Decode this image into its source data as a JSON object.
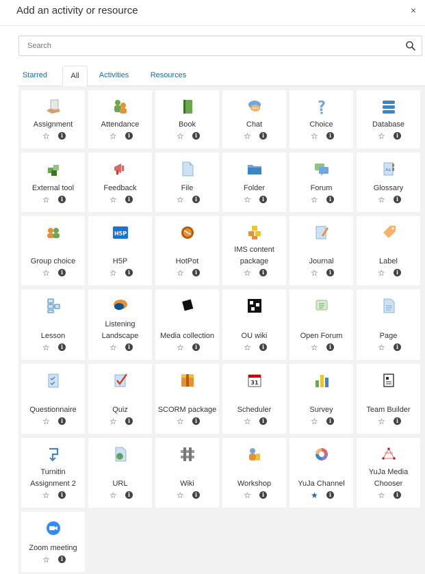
{
  "header": {
    "title": "Add an activity or resource",
    "close_glyph": "×"
  },
  "search": {
    "placeholder": "Search"
  },
  "tabs": [
    {
      "label": "Starred",
      "active": false
    },
    {
      "label": "All",
      "active": true
    },
    {
      "label": "Activities",
      "active": false
    },
    {
      "label": "Resources",
      "active": false
    }
  ],
  "items": [
    {
      "name": "Assignment",
      "icon": "assignment-icon",
      "starred": false
    },
    {
      "name": "Attendance",
      "icon": "attendance-icon",
      "starred": false
    },
    {
      "name": "Book",
      "icon": "book-icon",
      "starred": false
    },
    {
      "name": "Chat",
      "icon": "chat-icon",
      "starred": false
    },
    {
      "name": "Choice",
      "icon": "choice-icon",
      "starred": false
    },
    {
      "name": "Database",
      "icon": "database-icon",
      "starred": false
    },
    {
      "name": "External tool",
      "icon": "external-tool-icon",
      "starred": false
    },
    {
      "name": "Feedback",
      "icon": "feedback-icon",
      "starred": false
    },
    {
      "name": "File",
      "icon": "file-icon",
      "starred": false
    },
    {
      "name": "Folder",
      "icon": "folder-icon",
      "starred": false
    },
    {
      "name": "Forum",
      "icon": "forum-icon",
      "starred": false
    },
    {
      "name": "Glossary",
      "icon": "glossary-icon",
      "starred": false
    },
    {
      "name": "Group choice",
      "icon": "group-choice-icon",
      "starred": false
    },
    {
      "name": "H5P",
      "icon": "h5p-icon",
      "starred": false
    },
    {
      "name": "HotPot",
      "icon": "hotpot-icon",
      "starred": false
    },
    {
      "name": "IMS content package",
      "icon": "ims-package-icon",
      "starred": false
    },
    {
      "name": "Journal",
      "icon": "journal-icon",
      "starred": false
    },
    {
      "name": "Label",
      "icon": "label-icon",
      "starred": false
    },
    {
      "name": "Lesson",
      "icon": "lesson-icon",
      "starred": false
    },
    {
      "name": "Listening Landscape",
      "icon": "listening-landscape-icon",
      "starred": false
    },
    {
      "name": "Media collection",
      "icon": "media-collection-icon",
      "starred": false
    },
    {
      "name": "OU wiki",
      "icon": "ou-wiki-icon",
      "starred": false
    },
    {
      "name": "Open Forum",
      "icon": "open-forum-icon",
      "starred": false
    },
    {
      "name": "Page",
      "icon": "page-icon",
      "starred": false
    },
    {
      "name": "Questionnaire",
      "icon": "questionnaire-icon",
      "starred": false
    },
    {
      "name": "Quiz",
      "icon": "quiz-icon",
      "starred": false
    },
    {
      "name": "SCORM package",
      "icon": "scorm-icon",
      "starred": false
    },
    {
      "name": "Scheduler",
      "icon": "scheduler-icon",
      "starred": false
    },
    {
      "name": "Survey",
      "icon": "survey-icon",
      "starred": false
    },
    {
      "name": "Team Builder",
      "icon": "team-builder-icon",
      "starred": false
    },
    {
      "name": "Turnitin Assignment 2",
      "icon": "turnitin-icon",
      "starred": false
    },
    {
      "name": "URL",
      "icon": "url-icon",
      "starred": false
    },
    {
      "name": "Wiki",
      "icon": "wiki-icon",
      "starred": false
    },
    {
      "name": "Workshop",
      "icon": "workshop-icon",
      "starred": false
    },
    {
      "name": "YuJa Channel",
      "icon": "yuja-channel-icon",
      "starred": true
    },
    {
      "name": "YuJa Media Chooser",
      "icon": "yuja-media-chooser-icon",
      "starred": false
    },
    {
      "name": "Zoom meeting",
      "icon": "zoom-icon",
      "starred": false
    }
  ],
  "colors": {
    "link": "#0f6cbf",
    "tile_bg": "#ffffff",
    "content_bg": "#f2f2f2"
  }
}
